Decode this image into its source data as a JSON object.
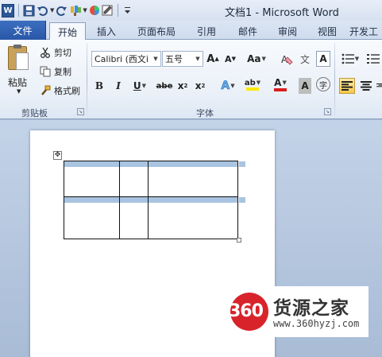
{
  "window": {
    "title": "文档1 - Microsoft Word",
    "app_icon": "W"
  },
  "quick_access": {
    "icons": [
      "word-logo-icon",
      "save-icon",
      "undo-icon",
      "redo-icon",
      "format-painter-icon",
      "theme-icon",
      "paste-special-icon",
      "customize-icon"
    ]
  },
  "tabs": [
    {
      "label": "文件"
    },
    {
      "label": "开始"
    },
    {
      "label": "插入"
    },
    {
      "label": "页面布局"
    },
    {
      "label": "引用"
    },
    {
      "label": "邮件"
    },
    {
      "label": "审阅"
    },
    {
      "label": "视图"
    },
    {
      "label": "开发工"
    }
  ],
  "clipboard": {
    "paste_label": "粘贴",
    "cut_label": "剪切",
    "copy_label": "复制",
    "format_painter_label": "格式刷",
    "group_label": "剪贴板"
  },
  "font": {
    "font_name": "Calibri (西文i",
    "font_size": "五号",
    "grow_label": "A",
    "shrink_label": "A",
    "change_case_label": "Aa",
    "phonetic_label": "文",
    "char_border_label": "A",
    "bold_label": "B",
    "italic_label": "I",
    "underline_label": "U",
    "strike_label": "abe",
    "subscript_label": "x",
    "superscript_label": "x",
    "sub_mark": "2",
    "sup_mark": "2",
    "text_effect_label": "A",
    "highlight_label": "ab",
    "font_color_label": "A",
    "char_shading_label": "A",
    "enclose_label": "字",
    "group_label": "字体"
  },
  "colors": {
    "file_tab": "#2a57a6",
    "font_color_bar": "#d81e1e",
    "highlight_bar": "#ffe800",
    "selection": "#a9c4e1"
  },
  "watermark": {
    "number": "360",
    "name": "货源之家",
    "url": "www.360hyzj.com"
  }
}
